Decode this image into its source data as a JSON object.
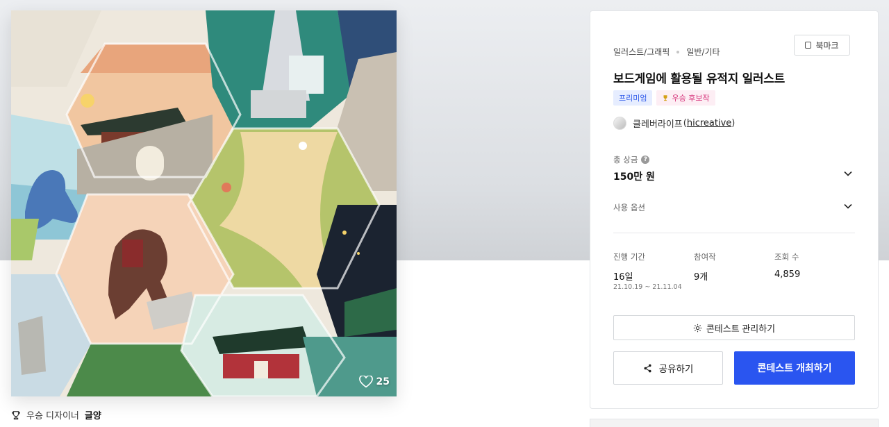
{
  "artwork": {
    "like_count": "25",
    "winner_label": "우승 디자이너",
    "winner_name": "글양"
  },
  "panel": {
    "category_main": "일러스트/그래픽",
    "category_sub": "일반/기타",
    "bookmark_label": "북마크",
    "title": "보드게임에 활용될 유적지 일러스트",
    "badge_premium": "프리미엄",
    "badge_candidate": "우승 후보작",
    "designer_name": "클레버라이프",
    "designer_handle": "hicreative",
    "prize_label": "총 상금",
    "prize_value": "150만 원",
    "usage_label": "사용 옵션",
    "stats": {
      "period_label": "진행 기간",
      "period_value": "16일",
      "period_dates": "21.10.19 ~ 21.11.04",
      "entries_label": "참여작",
      "entries_value": "9개",
      "views_label": "조회 수",
      "views_value": "4,859"
    },
    "manage_button": "콘테스트 관리하기",
    "share_button": "공유하기",
    "host_button": "콘테스트 개최하기"
  },
  "colors": {
    "accent": "#2a55f0",
    "premium_badge_bg": "#e6edff",
    "premium_badge_text": "#2f5bea",
    "candidate_badge_bg": "#fdeef4",
    "candidate_badge_text": "#d6337a"
  },
  "icons": [
    "heart-icon",
    "trophy-icon",
    "bookmark-icon",
    "help-icon",
    "chevron-down-icon",
    "gear-icon",
    "share-icon"
  ]
}
